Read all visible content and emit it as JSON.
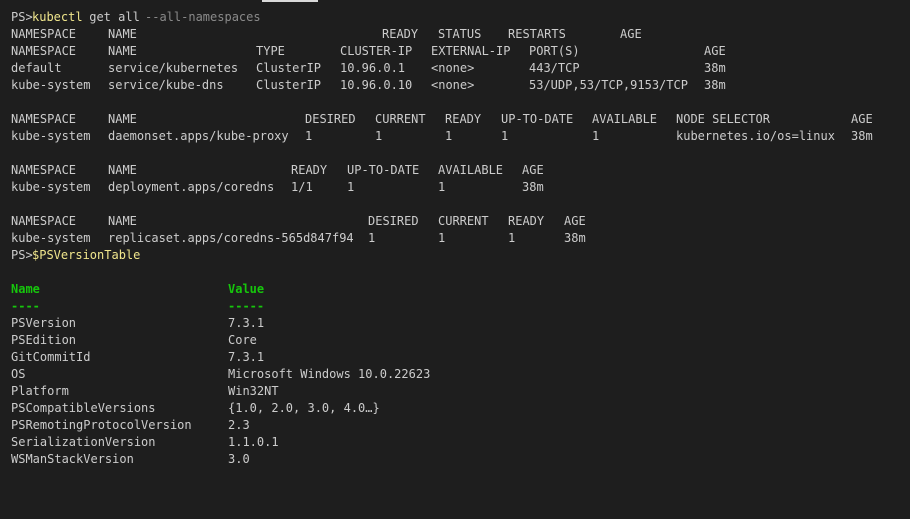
{
  "prompt1": {
    "ps": "PS>",
    "cmd": "kubectl",
    "args": " get all ",
    "flag": "--all-namespaces"
  },
  "section1": {
    "header1": [
      "NAMESPACE",
      "NAME",
      "READY",
      "STATUS",
      "RESTARTS",
      "AGE"
    ],
    "header2": [
      "NAMESPACE",
      "NAME",
      "TYPE",
      "CLUSTER-IP",
      "EXTERNAL-IP",
      "PORT(S)",
      "AGE"
    ],
    "rows": [
      [
        "default",
        "service/kubernetes",
        "ClusterIP",
        "10.96.0.1",
        "<none>",
        "443/TCP",
        "38m"
      ],
      [
        "kube-system",
        "service/kube-dns",
        "ClusterIP",
        "10.96.0.10",
        "<none>",
        "53/UDP,53/TCP,9153/TCP",
        "38m"
      ]
    ]
  },
  "section2": {
    "header": [
      "NAMESPACE",
      "NAME",
      "DESIRED",
      "CURRENT",
      "READY",
      "UP-TO-DATE",
      "AVAILABLE",
      "NODE SELECTOR",
      "AGE"
    ],
    "rows": [
      [
        "kube-system",
        "daemonset.apps/kube-proxy",
        "1",
        "1",
        "1",
        "1",
        "1",
        "kubernetes.io/os=linux",
        "38m"
      ]
    ]
  },
  "section3": {
    "header": [
      "NAMESPACE",
      "NAME",
      "READY",
      "UP-TO-DATE",
      "AVAILABLE",
      "AGE"
    ],
    "rows": [
      [
        "kube-system",
        "deployment.apps/coredns",
        "1/1",
        "1",
        "1",
        "38m"
      ]
    ]
  },
  "section4": {
    "header": [
      "NAMESPACE",
      "NAME",
      "DESIRED",
      "CURRENT",
      "READY",
      "AGE"
    ],
    "rows": [
      [
        "kube-system",
        "replicaset.apps/coredns-565d847f94",
        "1",
        "1",
        "1",
        "38m"
      ]
    ]
  },
  "prompt2": {
    "ps": "PS>",
    "cmd": "$PSVersionTable"
  },
  "version_table": {
    "header": [
      "Name",
      "Value"
    ],
    "dashes": [
      "----",
      "-----"
    ],
    "rows": [
      [
        "PSVersion",
        "7.3.1"
      ],
      [
        "PSEdition",
        "Core"
      ],
      [
        "GitCommitId",
        "7.3.1"
      ],
      [
        "OS",
        "Microsoft Windows 10.0.22623"
      ],
      [
        "Platform",
        "Win32NT"
      ],
      [
        "PSCompatibleVersions",
        "{1.0, 2.0, 3.0, 4.0…}"
      ],
      [
        "PSRemotingProtocolVersion",
        "2.3"
      ],
      [
        "SerializationVersion",
        "1.1.0.1"
      ],
      [
        "WSManStackVersion",
        "3.0"
      ]
    ]
  },
  "colors": {
    "background": "#1e1e1e",
    "text": "#cccccc",
    "prompt_command": "#f0e68c",
    "table_header": "#16c60c"
  }
}
